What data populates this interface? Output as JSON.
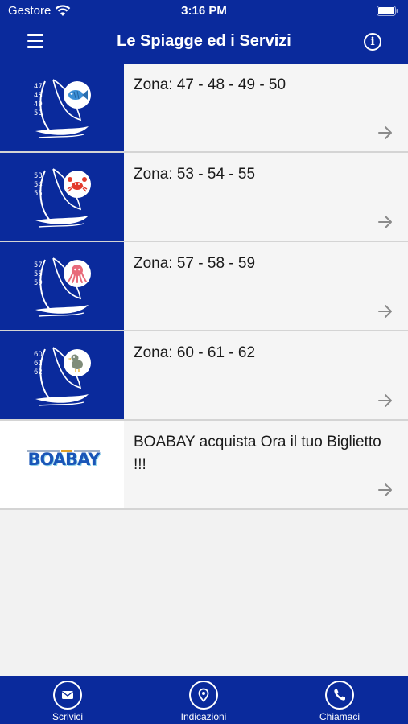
{
  "status_bar": {
    "carrier": "Gestore",
    "time": "3:16 PM"
  },
  "header": {
    "title": "Le Spiagge ed i Servizi"
  },
  "list": {
    "items": [
      {
        "title": "Zona: 47 - 48 - 49 - 50",
        "thumb_numbers": [
          "47",
          "48",
          "49",
          "50"
        ],
        "thumb_icon": "fish-icon",
        "thumb_color": "#0a2a9c"
      },
      {
        "title": "Zona: 53 - 54 - 55",
        "thumb_numbers": [
          "53",
          "54",
          "55"
        ],
        "thumb_icon": "crab-icon",
        "thumb_color": "#0a2a9c"
      },
      {
        "title": "Zona: 57 - 58 - 59",
        "thumb_numbers": [
          "57",
          "58",
          "59"
        ],
        "thumb_icon": "octopus-icon",
        "thumb_color": "#0a2a9c"
      },
      {
        "title": "Zona: 60 - 61 - 62",
        "thumb_numbers": [
          "60",
          "61",
          "62"
        ],
        "thumb_icon": "seagull-icon",
        "thumb_color": "#0a2a9c"
      },
      {
        "title": "BOABAY acquista Ora il tuo Biglietto !!!",
        "logo_text": "BOABAY",
        "thumb_color": "#ffffff"
      }
    ]
  },
  "tab_bar": {
    "tabs": [
      {
        "label": "Scrivici",
        "icon": "mail-icon"
      },
      {
        "label": "Indicazioni",
        "icon": "location-pin-icon"
      },
      {
        "label": "Chiamaci",
        "icon": "phone-icon"
      }
    ]
  },
  "colors": {
    "primary": "#0a2a9c",
    "background": "#f2f2f2",
    "separator": "#d4d4d4",
    "arrow": "#8a8a8a"
  }
}
